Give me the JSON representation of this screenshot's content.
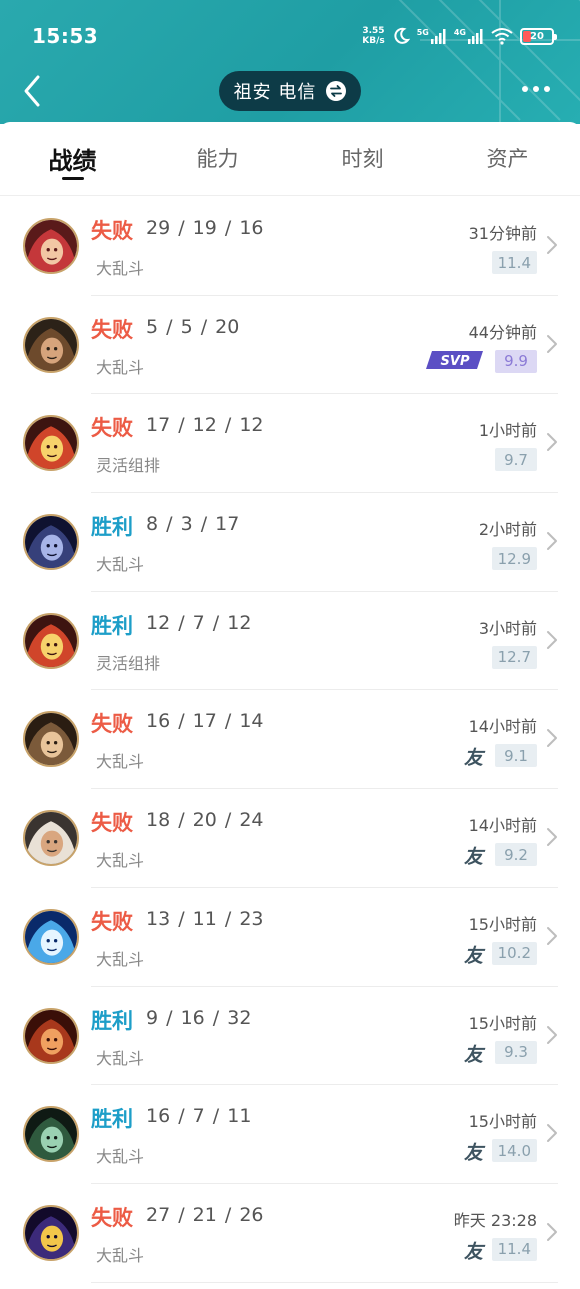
{
  "status_bar": {
    "time": "15:53",
    "net_speed_value": "3.55",
    "net_speed_unit": "KB/s",
    "sig1_label": "5G",
    "sig2_label": "4G",
    "battery": "20"
  },
  "header": {
    "server_label": "祖安 电信"
  },
  "tabs": [
    {
      "label": "战绩",
      "active": true
    },
    {
      "label": "能力",
      "active": false
    },
    {
      "label": "时刻",
      "active": false
    },
    {
      "label": "资产",
      "active": false
    }
  ],
  "colors": {
    "header": "#1f9ea4",
    "lose": "#ec5b45",
    "win": "#1d9ec8",
    "pill": "#0d3b47",
    "score_bg": "#e8eef2",
    "svp_bg": "#dcd8f4"
  },
  "matches": [
    {
      "result": "失败",
      "outcome": "lose",
      "kda": "29 / 19 / 16",
      "mode": "大乱斗",
      "time": "31分钟前",
      "score": "11.4",
      "badge": "",
      "avatar": "champion-red-hair"
    },
    {
      "result": "失败",
      "outcome": "lose",
      "kda": "5 / 5 / 20",
      "mode": "大乱斗",
      "time": "44分钟前",
      "score": "9.9",
      "badge": "svp",
      "badge_text": "SVP",
      "avatar": "champion-brown-hair"
    },
    {
      "result": "失败",
      "outcome": "lose",
      "kda": "17 / 12 / 12",
      "mode": "灵活组排",
      "time": "1小时前",
      "score": "9.7",
      "badge": "",
      "avatar": "champion-red-creature"
    },
    {
      "result": "胜利",
      "outcome": "win",
      "kda": "8 / 3 / 17",
      "mode": "大乱斗",
      "time": "2小时前",
      "score": "12.9",
      "badge": "",
      "avatar": "champion-dark-blue"
    },
    {
      "result": "胜利",
      "outcome": "win",
      "kda": "12 / 7 / 12",
      "mode": "灵活组排",
      "time": "3小时前",
      "score": "12.7",
      "badge": "",
      "avatar": "champion-red-creature"
    },
    {
      "result": "失败",
      "outcome": "lose",
      "kda": "16 / 17 / 14",
      "mode": "大乱斗",
      "time": "14小时前",
      "score": "9.1",
      "badge": "friend",
      "badge_text": "友",
      "avatar": "champion-grinning-man"
    },
    {
      "result": "失败",
      "outcome": "lose",
      "kda": "18 / 20 / 24",
      "mode": "大乱斗",
      "time": "14小时前",
      "score": "9.2",
      "badge": "friend",
      "badge_text": "友",
      "avatar": "champion-white-hood"
    },
    {
      "result": "失败",
      "outcome": "lose",
      "kda": "13 / 11 / 23",
      "mode": "大乱斗",
      "time": "15小时前",
      "score": "10.2",
      "badge": "friend",
      "badge_text": "友",
      "avatar": "champion-ice-dragon"
    },
    {
      "result": "胜利",
      "outcome": "win",
      "kda": "9 / 16 / 32",
      "mode": "大乱斗",
      "time": "15小时前",
      "score": "9.3",
      "badge": "friend",
      "badge_text": "友",
      "avatar": "champion-fire-face"
    },
    {
      "result": "胜利",
      "outcome": "win",
      "kda": "16 / 7 / 11",
      "mode": "大乱斗",
      "time": "15小时前",
      "score": "14.0",
      "badge": "friend",
      "badge_text": "友",
      "avatar": "champion-green-hat"
    },
    {
      "result": "失败",
      "outcome": "lose",
      "kda": "27 / 21 / 26",
      "mode": "大乱斗",
      "time": "昨天 23:28",
      "score": "11.4",
      "badge": "friend",
      "badge_text": "友",
      "avatar": "champion-purple-hat"
    }
  ]
}
